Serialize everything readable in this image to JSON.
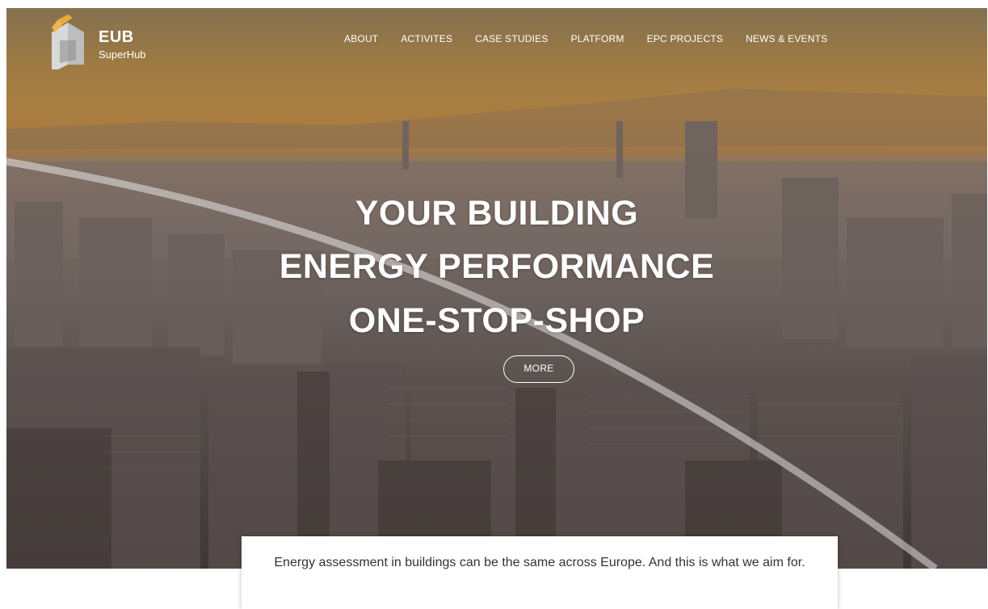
{
  "brand": {
    "title": "EUB",
    "subtitle": "SuperHub",
    "accent": "#e8a93b"
  },
  "nav": {
    "items": [
      {
        "label": "ABOUT"
      },
      {
        "label": "ACTIVITES"
      },
      {
        "label": "CASE STUDIES"
      },
      {
        "label": "PLATFORM"
      },
      {
        "label": "EPC PROJECTS"
      },
      {
        "label": "NEWS & EVENTS"
      }
    ]
  },
  "hero": {
    "line1": "YOUR BUILDING",
    "line2": "ENERGY PERFORMANCE",
    "line3": "ONE-STOP-SHOP",
    "button": "MORE"
  },
  "intro": {
    "text": "Energy assessment in buildings can be the same across Europe. And this is what we aim for."
  }
}
